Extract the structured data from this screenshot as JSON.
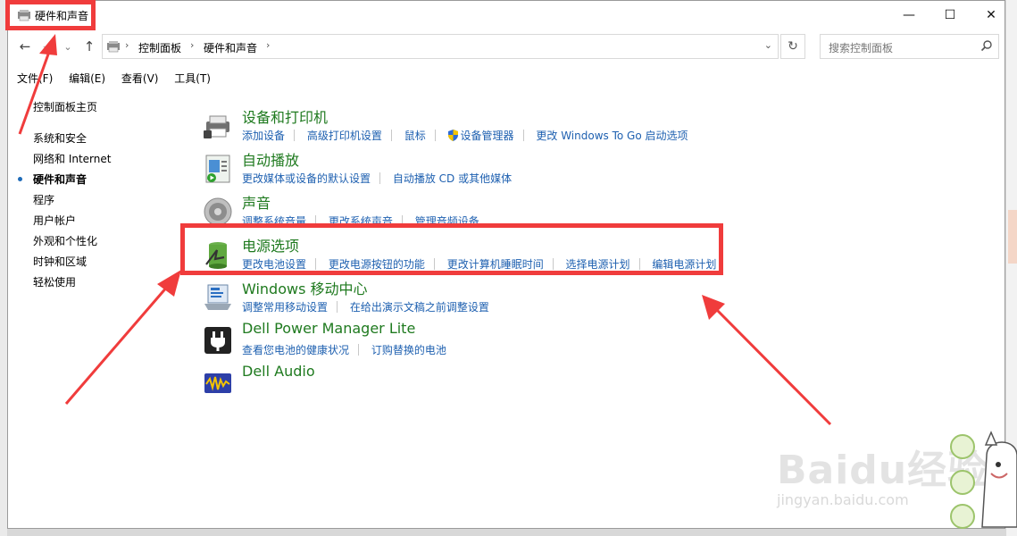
{
  "window": {
    "title": "硬件和声音",
    "caption": {
      "minimize": "—",
      "maximize": "☐",
      "close": "✕"
    }
  },
  "nav": {
    "back": "←",
    "forward": "→",
    "recent": "⌄",
    "up": "↑",
    "breadcrumb": [
      "控制面板",
      "硬件和声音"
    ],
    "breadcrumb_sep": "›",
    "dropdown": "⌄",
    "refresh": "↻",
    "search_placeholder": "搜索控制面板"
  },
  "menu": [
    "文件(F)",
    "编辑(E)",
    "查看(V)",
    "工具(T)"
  ],
  "sidebar": {
    "home": "控制面板主页",
    "items": [
      {
        "label": "系统和安全",
        "active": false
      },
      {
        "label": "网络和 Internet",
        "active": false
      },
      {
        "label": "硬件和声音",
        "active": true
      },
      {
        "label": "程序",
        "active": false
      },
      {
        "label": "用户帐户",
        "active": false
      },
      {
        "label": "外观和个性化",
        "active": false
      },
      {
        "label": "时钟和区域",
        "active": false
      },
      {
        "label": "轻松使用",
        "active": false
      }
    ]
  },
  "categories": [
    {
      "title": "设备和打印机",
      "icon": "printer-icon",
      "links": [
        "添加设备",
        "高级打印机设置",
        "鼠标",
        "设备管理器",
        "更改 Windows To Go 启动选项"
      ]
    },
    {
      "title": "自动播放",
      "icon": "autoplay-icon",
      "links": [
        "更改媒体或设备的默认设置",
        "自动播放 CD 或其他媒体"
      ]
    },
    {
      "title": "声音",
      "icon": "speaker-icon",
      "links": [
        "调整系统音量",
        "更改系统声音",
        "管理音频设备"
      ]
    },
    {
      "title": "电源选项",
      "icon": "battery-icon",
      "links": [
        "更改电池设置",
        "更改电源按钮的功能",
        "更改计算机睡眠时间",
        "选择电源计划",
        "编辑电源计划"
      ]
    },
    {
      "title": "Windows 移动中心",
      "icon": "mobility-center-icon",
      "links": [
        "调整常用移动设置",
        "在给出演示文稿之前调整设置"
      ]
    },
    {
      "title": "Dell Power Manager Lite",
      "icon": "power-plug-icon",
      "links": [
        "查看您电池的健康状况",
        "订购替换的电池"
      ]
    },
    {
      "title": "Dell Audio",
      "icon": "dell-audio-icon",
      "links": []
    }
  ],
  "watermark": {
    "brand": "Baidu经验",
    "url": "jingyan.baidu.com"
  },
  "colors": {
    "link": "#1e60b0",
    "category_title": "#1f7a1f",
    "highlight": "#f03c3c"
  }
}
